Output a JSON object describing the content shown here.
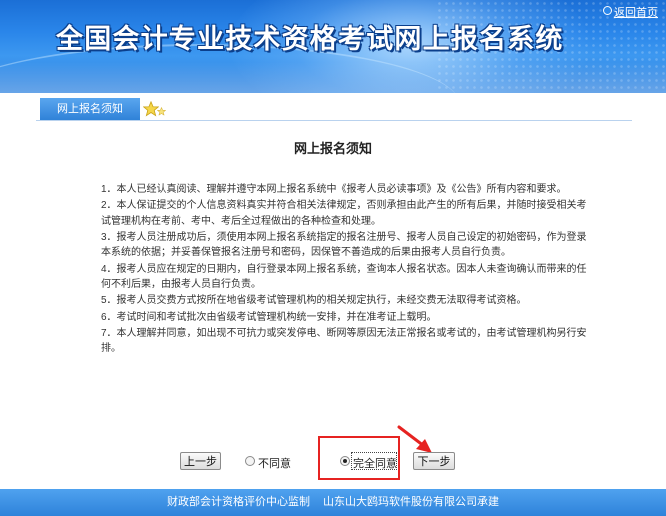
{
  "header": {
    "title": "全国会计专业技术资格考试网上报名系统",
    "home_link": "返回首页"
  },
  "tab": {
    "label": "网上报名须知"
  },
  "notice": {
    "title": "网上报名须知",
    "items": [
      "1．本人已经认真阅读、理解并遵守本网上报名系统中《报考人员必读事项》及《公告》所有内容和要求。",
      "2．本人保证提交的个人信息资料真实并符合相关法律规定，否则承担由此产生的所有后果，并随时接受相关考试管理机构在考前、考中、考后全过程做出的各种检查和处理。",
      "3．报考人员注册成功后，须使用本网上报名系统指定的报名注册号、报考人员自己设定的初始密码，作为登录本系统的依据；并妥善保管报名注册号和密码，因保管不善造成的后果由报考人员自行负责。",
      "4．报考人员应在规定的日期内，自行登录本网上报名系统，查询本人报名状态。因本人未查询确认而带来的任何不利后果，由报考人员自行负责。",
      "5．报考人员交费方式按所在地省级考试管理机构的相关规定执行，未经交费无法取得考试资格。",
      "6．考试时间和考试批次由省级考试管理机构统一安排，并在准考证上载明。",
      "7．本人理解并同意，如出现不可抗力或突发停电、断网等原因无法正常报名或考试的，由考试管理机构另行安排。"
    ]
  },
  "controls": {
    "prev_label": "上一步",
    "disagree_label": "不同意",
    "agree_label": "完全同意",
    "next_label": "下一步",
    "selected": "agree"
  },
  "footer": {
    "left": "财政部会计资格评价中心监制",
    "right": "山东山大鸥玛软件股份有限公司承建"
  },
  "colors": {
    "header_blue": "#2a86ea",
    "footer_blue": "#3a8fe4",
    "highlight_red": "#e62321"
  }
}
